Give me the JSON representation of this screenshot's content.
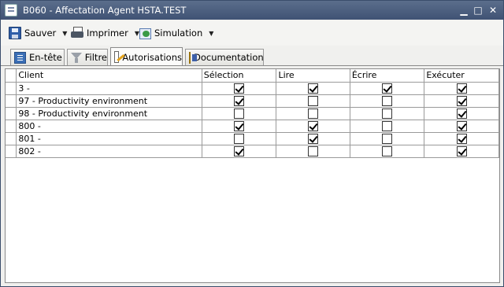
{
  "window": {
    "title": "B060 - Affectation Agent HSTA.TEST"
  },
  "toolbar": {
    "save_label": "Sauver",
    "print_label": "Imprimer",
    "simulation_label": "Simulation"
  },
  "tabs": [
    {
      "label": "En-tête",
      "active": false
    },
    {
      "label": "Filtre",
      "active": false
    },
    {
      "label": "Autorisations",
      "active": true
    },
    {
      "label": "Documentation",
      "active": false
    }
  ],
  "grid": {
    "columns": [
      "Client",
      "Sélection",
      "Lire",
      "Écrire",
      "Exécuter"
    ],
    "rows": [
      {
        "client": "3 -",
        "selection": true,
        "lire": true,
        "ecrire": true,
        "executer": true
      },
      {
        "client": "97 - Productivity environment",
        "selection": true,
        "lire": false,
        "ecrire": false,
        "executer": true
      },
      {
        "client": "98 - Productivity environment",
        "selection": false,
        "lire": false,
        "ecrire": false,
        "executer": true
      },
      {
        "client": "800 -",
        "selection": true,
        "lire": true,
        "ecrire": false,
        "executer": true
      },
      {
        "client": "801 -",
        "selection": false,
        "lire": true,
        "ecrire": false,
        "executer": true
      },
      {
        "client": "802 -",
        "selection": true,
        "lire": false,
        "ecrire": false,
        "executer": true
      }
    ]
  }
}
